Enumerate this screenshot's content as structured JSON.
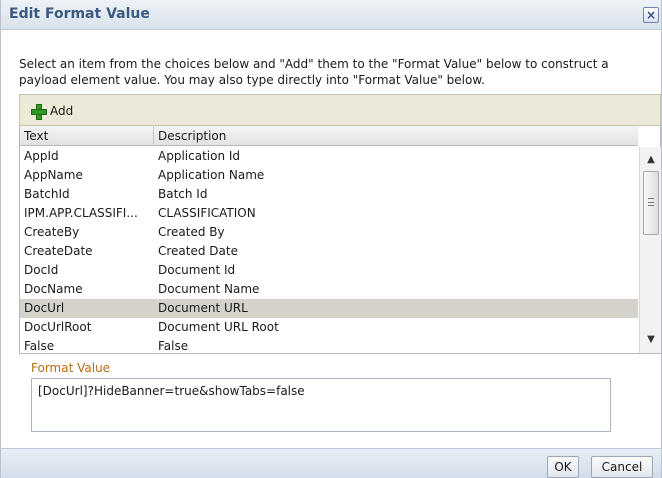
{
  "dialog": {
    "title": "Edit Format Value",
    "close_icon": "close-icon",
    "close_glyph": "×",
    "instructions": "Select an item from the choices below and \"Add\" them to the \"Format Value\" below to construct a payload element value. You may also type directly into \"Format Value\" below."
  },
  "toolbar": {
    "add_label": "Add",
    "add_icon": "plus-icon",
    "add_icon_color": "#2f9a23"
  },
  "table": {
    "columns": [
      "Text",
      "Description"
    ],
    "rows": [
      {
        "text": "AppId",
        "description": "Application Id"
      },
      {
        "text": "AppName",
        "description": "Application Name"
      },
      {
        "text": "BatchId",
        "description": "Batch Id"
      },
      {
        "text": "IPM.APP.CLASSIFI...",
        "description": "CLASSIFICATION"
      },
      {
        "text": "CreateBy",
        "description": "Created By"
      },
      {
        "text": "CreateDate",
        "description": "Created Date"
      },
      {
        "text": "DocId",
        "description": "Document Id"
      },
      {
        "text": "DocName",
        "description": "Document Name"
      },
      {
        "text": "DocUrl",
        "description": "Document URL",
        "selected": true
      },
      {
        "text": "DocUrlRoot",
        "description": "Document URL Root"
      },
      {
        "text": "False",
        "description": "False"
      }
    ],
    "scroll_up_icon": "scroll-up-arrow-icon",
    "scroll_down_icon": "scroll-down-arrow-icon",
    "scroll_up_glyph": "▲",
    "scroll_down_glyph": "▼"
  },
  "format_value": {
    "label": "Format Value",
    "value": "[DocUrl]?HideBanner=true&showTabs=false",
    "label_color": "#b76c11"
  },
  "footer": {
    "ok_label": "OK",
    "cancel_label": "Cancel"
  },
  "colors": {
    "title": "#3b5a82",
    "selected_row": "#d4d2ca",
    "toolbar_bg": "#ece9d8"
  }
}
